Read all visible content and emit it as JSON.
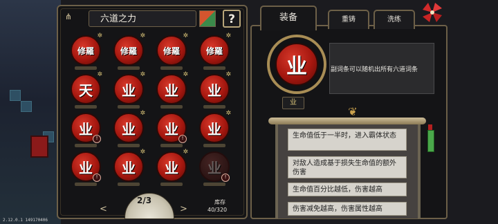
{
  "left_panel": {
    "title": "六道之力",
    "help_label": "?",
    "icons": [
      {
        "glyph": "修羅",
        "badge": "",
        "starred": true
      },
      {
        "glyph": "修羅",
        "badge": "",
        "starred": true
      },
      {
        "glyph": "修羅",
        "badge": "",
        "starred": true
      },
      {
        "glyph": "修羅",
        "badge": "",
        "starred": true
      },
      {
        "glyph": "天",
        "badge": "",
        "starred": true
      },
      {
        "glyph": "业",
        "badge": "",
        "starred": true
      },
      {
        "glyph": "业",
        "badge": "",
        "starred": true
      },
      {
        "glyph": "业",
        "badge": "",
        "starred": true
      },
      {
        "glyph": "业",
        "badge": "",
        "starred": false
      },
      {
        "glyph": "业",
        "badge": "",
        "starred": true
      },
      {
        "glyph": "业",
        "badge": "",
        "starred": false
      },
      {
        "glyph": "业",
        "badge": "",
        "starred": true
      },
      {
        "glyph": "业",
        "badge": "",
        "starred": false
      },
      {
        "glyph": "业",
        "badge": "",
        "starred": true
      },
      {
        "glyph": "业",
        "badge": "",
        "starred": true
      },
      {
        "glyph": "业",
        "badge": "",
        "starred": false,
        "dim": true
      }
    ],
    "page_prev": "<",
    "page_next": ">",
    "page_indicator": "2/3",
    "stock_label": "库存",
    "stock_value": "40/320"
  },
  "right_panel": {
    "tabs": [
      "装备",
      "重铸",
      "洗练"
    ],
    "equipped_glyph": "业",
    "description": "副词条可以随机出所有六道词条",
    "emblem_glyph": "业",
    "affixes": [
      "生命值低于一半时，进入霸体状态",
      "对敌人造成基于损失生命值的额外伤害",
      "生命值百分比越低，伤害越高",
      "伤害减免越高，伤害属性越高"
    ]
  },
  "version": "2.12.0.1 149170406",
  "colors": {
    "accent_gold": "#b8a67a",
    "icon_red": "#a5170f",
    "affix_bg": "#d6d3cc"
  }
}
